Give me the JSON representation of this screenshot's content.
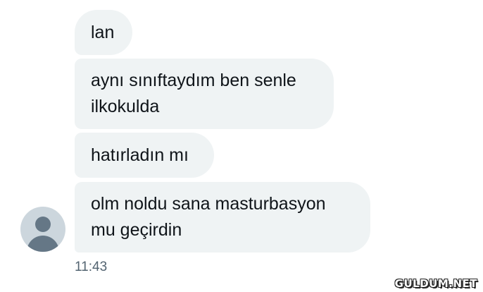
{
  "conversation": {
    "messages": [
      {
        "text": "lan"
      },
      {
        "text": "aynı sınıftaydım ben senle\nilkokulda"
      },
      {
        "text": "hatırladın mı"
      },
      {
        "text": "olm noldu sana masturbasyon\nmu geçirdin"
      }
    ],
    "timestamp": "11:43",
    "sender_avatar": "default-profile-avatar"
  },
  "watermark": "GULDUM.NET",
  "colors": {
    "bubble_background": "#eff3f4",
    "text": "#0f1419",
    "timestamp": "#536471",
    "avatar_background": "#ccd6dd",
    "avatar_figure": "#657786"
  }
}
